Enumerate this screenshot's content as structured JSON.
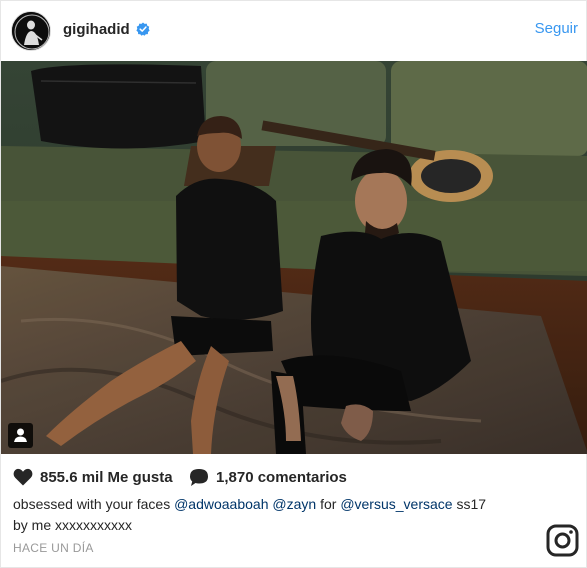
{
  "header": {
    "username": "gigihadid",
    "follow_label": "Seguir"
  },
  "actions": {
    "likes": "855.6 mil Me gusta",
    "comments": "1,870 comentarios"
  },
  "caption": {
    "text_before": "obsessed with your faces ",
    "mention_1": "@adwoaaboah",
    "mention_2": "@zayn",
    "text_mid": " for ",
    "mention_3": "@versus_versace",
    "text_after": " ss17",
    "line_2": "by me xxxxxxxxxxx"
  },
  "timestamp": "HACE UN DÍA",
  "icons": {
    "verified": "verified-badge-icon",
    "heart": "heart-icon",
    "comment": "comment-bubble-icon",
    "tag": "user-tag-icon",
    "logo": "instagram-logo-icon"
  },
  "colors": {
    "accent": "#3897f0",
    "mention": "#003569",
    "meta": "#999999"
  }
}
